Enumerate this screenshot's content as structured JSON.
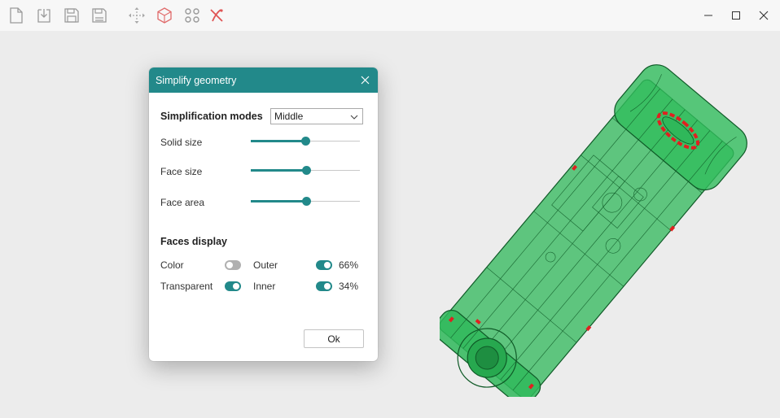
{
  "toolbar": {
    "icons": [
      "new-file-icon",
      "import-icon",
      "save-icon",
      "save-as-icon",
      "move-icon",
      "box-3d-icon",
      "components-icon",
      "cut-icon"
    ]
  },
  "window": {
    "controls": [
      "minimize-icon",
      "maximize-icon",
      "close-icon"
    ]
  },
  "dialog": {
    "title": "Simplify geometry",
    "modes_label": "Simplification modes",
    "mode_value": "Middle",
    "sliders": [
      {
        "label": "Solid size",
        "value": 0.5
      },
      {
        "label": "Face size",
        "value": 0.51
      },
      {
        "label": "Face area",
        "value": 0.51
      }
    ],
    "faces_display_label": "Faces display",
    "color_label": "Color",
    "color_on": false,
    "transparent_label": "Transparent",
    "transparent_on": true,
    "outer_label": "Outer",
    "outer_on": true,
    "outer_pct": "66%",
    "inner_label": "Inner",
    "inner_on": true,
    "inner_pct": "34%",
    "ok_label": "Ok"
  },
  "colors": {
    "accent": "#22898a",
    "model_green": "#1fae4a",
    "model_red": "#e02020"
  }
}
